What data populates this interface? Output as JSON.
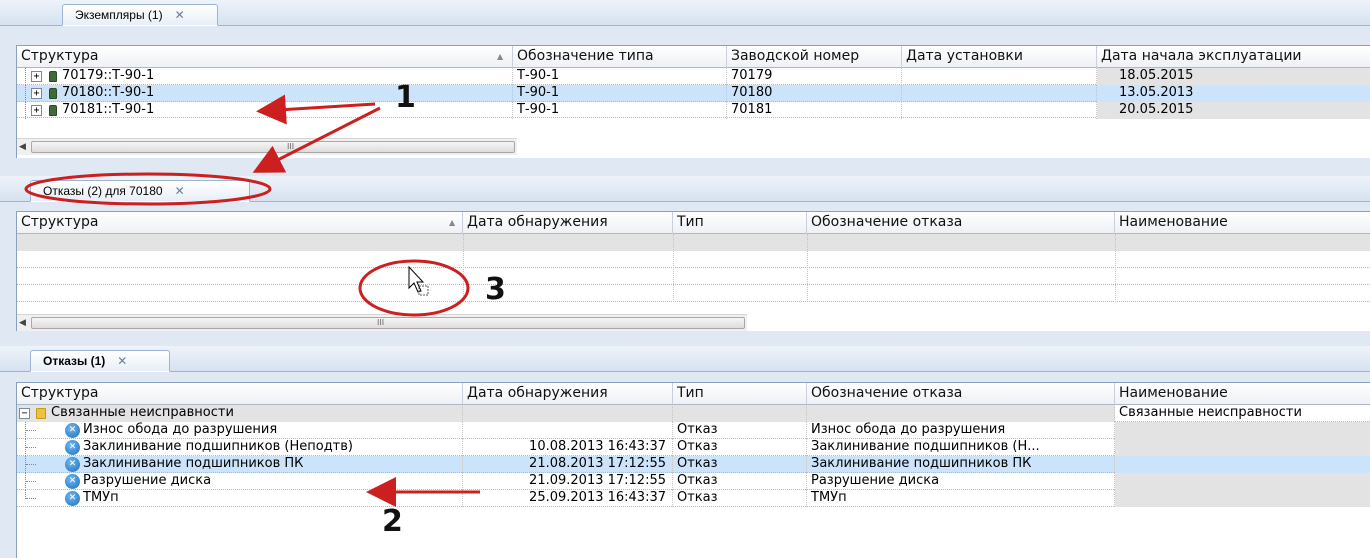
{
  "colors": {
    "accent": "#cc1f1f",
    "selection": "#cce4fb",
    "shade": "#e3e3e3"
  },
  "panel1": {
    "tab": {
      "label": "Экземпляры (1)",
      "close_icon": "close-icon"
    },
    "columns": [
      "Структура",
      "Обозначение типа",
      "Заводской номер",
      "Дата установки",
      "Дата начала эксплуатации"
    ],
    "rows": [
      {
        "name": "70179::Т-90-1",
        "type": "Т-90-1",
        "serial": "70179",
        "installed": "",
        "start": "18.05.2015"
      },
      {
        "name": "70180::Т-90-1",
        "type": "Т-90-1",
        "serial": "70180",
        "installed": "",
        "start": "13.05.2013"
      },
      {
        "name": "70181::Т-90-1",
        "type": "Т-90-1",
        "serial": "70181",
        "installed": "",
        "start": "20.05.2015"
      }
    ],
    "scroll_grip": "III"
  },
  "panel2": {
    "tab": {
      "label": "Отказы (2) для 70180"
    },
    "columns": [
      "Структура",
      "Дата обнаружения",
      "Тип",
      "Обозначение отказа",
      "Наименование"
    ],
    "scroll_grip": "III"
  },
  "panel3": {
    "tab": {
      "label": "Отказы (1)"
    },
    "columns": [
      "Структура",
      "Дата обнаружения",
      "Тип",
      "Обозначение отказа",
      "Наименование"
    ],
    "group": {
      "label": "Связанные неисправности",
      "name": "Связанные неисправности"
    },
    "rows": [
      {
        "name": "Износ обода до разрушения",
        "date": "",
        "type": "Отказ",
        "code": "Износ обода до разрушения"
      },
      {
        "name": "Заклинивание подшипников (Неподтв)",
        "date": "10.08.2013 16:43:37",
        "type": "Отказ",
        "code": "Заклинивание подшипников (Н..."
      },
      {
        "name": "Заклинивание подшипников ПК",
        "date": "21.08.2013 17:12:55",
        "type": "Отказ",
        "code": "Заклинивание подшипников ПК"
      },
      {
        "name": "Разрушение диска",
        "date": "21.09.2013 17:12:55",
        "type": "Отказ",
        "code": "Разрушение диска"
      },
      {
        "name": "ТМУп",
        "date": "25.09.2013 16:43:37",
        "type": "Отказ",
        "code": "ТМУп"
      }
    ]
  },
  "annotations": {
    "n1": "1",
    "n2": "2",
    "n3": "3"
  }
}
